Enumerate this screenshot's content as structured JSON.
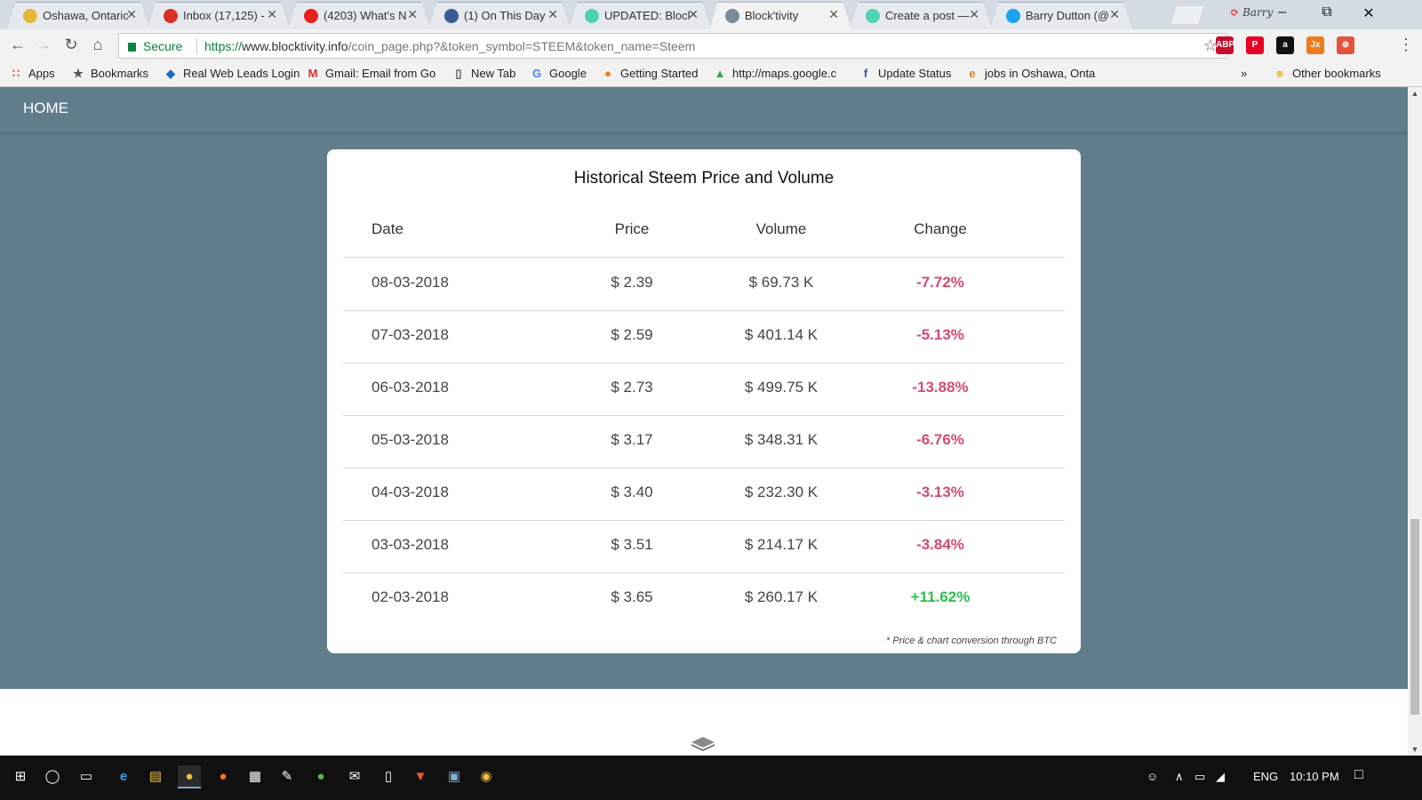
{
  "tabs": [
    {
      "title": "Oshawa, Ontario",
      "icon": "weather-icon",
      "color": "#e8b53b"
    },
    {
      "title": "Inbox (17,125) -",
      "icon": "gmail-icon",
      "color": "#d93025"
    },
    {
      "title": "(4203) What's N",
      "icon": "youtube-icon",
      "color": "#e62117"
    },
    {
      "title": "(1) On This Day",
      "icon": "facebook-icon",
      "color": "#3b5998"
    },
    {
      "title": "UPDATED: Block",
      "icon": "steemit-icon",
      "color": "#4ed2b4"
    },
    {
      "title": "Block'tivity",
      "icon": "blocktivity-icon",
      "color": "#7a8a99"
    },
    {
      "title": "Create a post —",
      "icon": "steemit-icon",
      "color": "#4ed2b4"
    },
    {
      "title": "Barry Dutton (@",
      "icon": "twitter-icon",
      "color": "#1da1f2"
    }
  ],
  "profile_name": "Barry",
  "toolbar": {
    "secure_label": "Secure",
    "url_scheme": "https://",
    "url_host": "www.blocktivity.info",
    "url_rest": "/coin_page.php?&token_symbol=STEEM&token_name=Steem"
  },
  "extensions": [
    {
      "name": "adblock-icon",
      "label": "ABP",
      "color": "#c70d2c"
    },
    {
      "name": "pinterest-icon",
      "label": "P",
      "color": "#e60023"
    },
    {
      "name": "amazon-icon",
      "label": "a",
      "color": "#111111"
    },
    {
      "name": "jx-icon",
      "label": "Jx",
      "color": "#f07b1a"
    },
    {
      "name": "extension-red-icon",
      "label": "⊗",
      "color": "#e5533d"
    }
  ],
  "bookmarks": [
    {
      "label": "Apps",
      "icon": "apps-grid-icon"
    },
    {
      "label": "Bookmarks",
      "icon": "star-icon"
    },
    {
      "label": "Real Web Leads Login",
      "icon": "realweb-icon"
    },
    {
      "label": "Gmail: Email from Go",
      "icon": "gmail-icon"
    },
    {
      "label": "New Tab",
      "icon": "page-icon"
    },
    {
      "label": "Google",
      "icon": "google-icon"
    },
    {
      "label": "Getting Started",
      "icon": "firefox-icon"
    },
    {
      "label": "http://maps.google.c",
      "icon": "maps-icon"
    },
    {
      "label": "Update Status",
      "icon": "facebook-icon"
    },
    {
      "label": "jobs in Oshawa, Onta",
      "icon": "ie-icon"
    }
  ],
  "bookmarks_overflow": "»",
  "other_bookmarks": "Other bookmarks",
  "nav": {
    "home": "HOME"
  },
  "table": {
    "title": "Historical Steem Price and Volume",
    "headers": [
      "Date",
      "Price",
      "Volume",
      "Change"
    ],
    "rows": [
      {
        "date": "08-03-2018",
        "price": "$ 2.39",
        "volume": "$ 69.73 K",
        "change": "-7.72%",
        "trend": "down"
      },
      {
        "date": "07-03-2018",
        "price": "$ 2.59",
        "volume": "$ 401.14 K",
        "change": "-5.13%",
        "trend": "down"
      },
      {
        "date": "06-03-2018",
        "price": "$ 2.73",
        "volume": "$ 499.75 K",
        "change": "-13.88%",
        "trend": "down"
      },
      {
        "date": "05-03-2018",
        "price": "$ 3.17",
        "volume": "$ 348.31 K",
        "change": "-6.76%",
        "trend": "down"
      },
      {
        "date": "04-03-2018",
        "price": "$ 3.40",
        "volume": "$ 232.30 K",
        "change": "-3.13%",
        "trend": "down"
      },
      {
        "date": "03-03-2018",
        "price": "$ 3.51",
        "volume": "$ 214.17 K",
        "change": "-3.84%",
        "trend": "down"
      },
      {
        "date": "02-03-2018",
        "price": "$ 3.65",
        "volume": "$ 260.17 K",
        "change": "+11.62%",
        "trend": "up"
      }
    ],
    "note": "* Price & chart conversion through BTC"
  },
  "colors": {
    "page_bg": "#617d8b",
    "negative": "#d44b6f",
    "positive": "#2fbf4f"
  },
  "taskbar": {
    "language": "ENG",
    "time": "10:10 PM"
  }
}
